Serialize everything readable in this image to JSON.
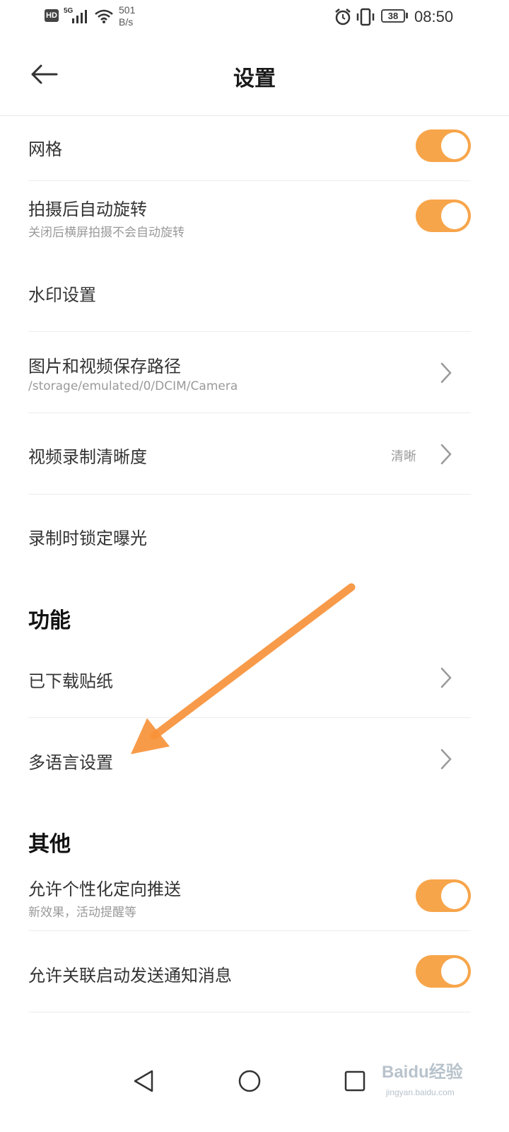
{
  "status_bar": {
    "hd": "HD",
    "network": "5G",
    "speed_value": "501",
    "speed_unit": "B/s",
    "battery": "38",
    "time": "08:50"
  },
  "header": {
    "title": "设置"
  },
  "rows": {
    "grid": {
      "label": "网格",
      "on": true
    },
    "auto_rotate": {
      "label": "拍摄后自动旋转",
      "sub": "关闭后横屏拍摄不会自动旋转",
      "on": true
    },
    "watermark": {
      "label": "水印设置"
    },
    "save_path": {
      "label": "图片和视频保存路径",
      "sub": "/storage/emulated/0/DCIM/Camera"
    },
    "video_quality": {
      "label": "视频录制清晰度",
      "value": "清晰"
    },
    "lock_exposure": {
      "label": "录制时锁定曝光"
    }
  },
  "sections": {
    "features": {
      "title": "功能",
      "stickers": {
        "label": "已下载贴纸"
      },
      "language": {
        "label": "多语言设置"
      }
    },
    "other": {
      "title": "其他",
      "push": {
        "label": "允许个性化定向推送",
        "sub": "新效果，活动提醒等",
        "on": true
      },
      "notify": {
        "label": "允许关联启动发送通知消息",
        "on": true
      }
    }
  },
  "watermark_overlay": {
    "brand": "Bai",
    "brand2": "du",
    "brand3": "经验",
    "site": "jingyan.baidu.com"
  },
  "colors": {
    "accent": "#f7a54a",
    "arrow": "#f7923a",
    "divider": "#ececec",
    "subtext": "#9a9a9a"
  }
}
